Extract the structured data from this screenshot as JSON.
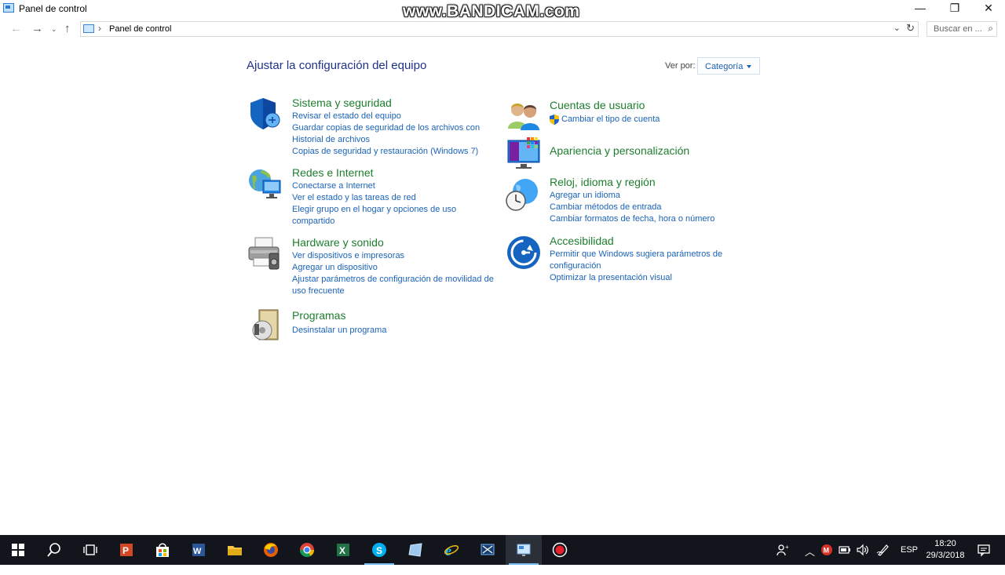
{
  "window": {
    "title": "Panel de control",
    "watermark": "www.BANDICAM.com",
    "minimize_glyph": "—",
    "restore_glyph": "❐",
    "close_glyph": "✕"
  },
  "address": {
    "path": "Panel de control",
    "search_placeholder": "Buscar en ..."
  },
  "page": {
    "title": "Ajustar la configuración del equipo",
    "view_by_label": "Ver por:",
    "view_by_value": "Categoría"
  },
  "categories": {
    "sistema": {
      "title": "Sistema y seguridad",
      "links": [
        "Revisar el estado del equipo",
        "Guardar copias de seguridad de los archivos con Historial de archivos",
        "Copias de seguridad y restauración (Windows 7)"
      ]
    },
    "redes": {
      "title": "Redes e Internet",
      "links": [
        "Conectarse a Internet",
        "Ver el estado y las tareas de red",
        "Elegir grupo en el hogar y opciones de uso compartido"
      ]
    },
    "hardware": {
      "title": "Hardware y sonido",
      "links": [
        "Ver dispositivos e impresoras",
        "Agregar un dispositivo",
        "Ajustar parámetros de configuración de movilidad de uso frecuente"
      ]
    },
    "programas": {
      "title": "Programas",
      "links": [
        "Desinstalar un programa"
      ]
    },
    "cuentas": {
      "title": "Cuentas de usuario",
      "links": [
        "Cambiar el tipo de cuenta"
      ]
    },
    "apariencia": {
      "title": "Apariencia y personalización",
      "links": []
    },
    "reloj": {
      "title": "Reloj, idioma y región",
      "links": [
        "Agregar un idioma",
        "Cambiar métodos de entrada",
        "Cambiar formatos de fecha, hora o número"
      ]
    },
    "accesibilidad": {
      "title": "Accesibilidad",
      "links": [
        "Permitir que Windows sugiera parámetros de configuración",
        "Optimizar la presentación visual"
      ]
    }
  },
  "taskbar": {
    "apps": [
      "start",
      "search",
      "task-view",
      "powerpoint",
      "store",
      "word",
      "file-explorer",
      "firefox",
      "chrome",
      "excel",
      "skype",
      "app-blue",
      "internet-explorer",
      "snipping-tool",
      "control-panel",
      "bandicam"
    ],
    "language": "ESP",
    "time": "18:20",
    "date": "29/3/2018"
  },
  "colors": {
    "category_title": "#1e7e2e",
    "link": "#1b63b8",
    "page_title": "#1e3287",
    "taskbar": "#12161c"
  }
}
